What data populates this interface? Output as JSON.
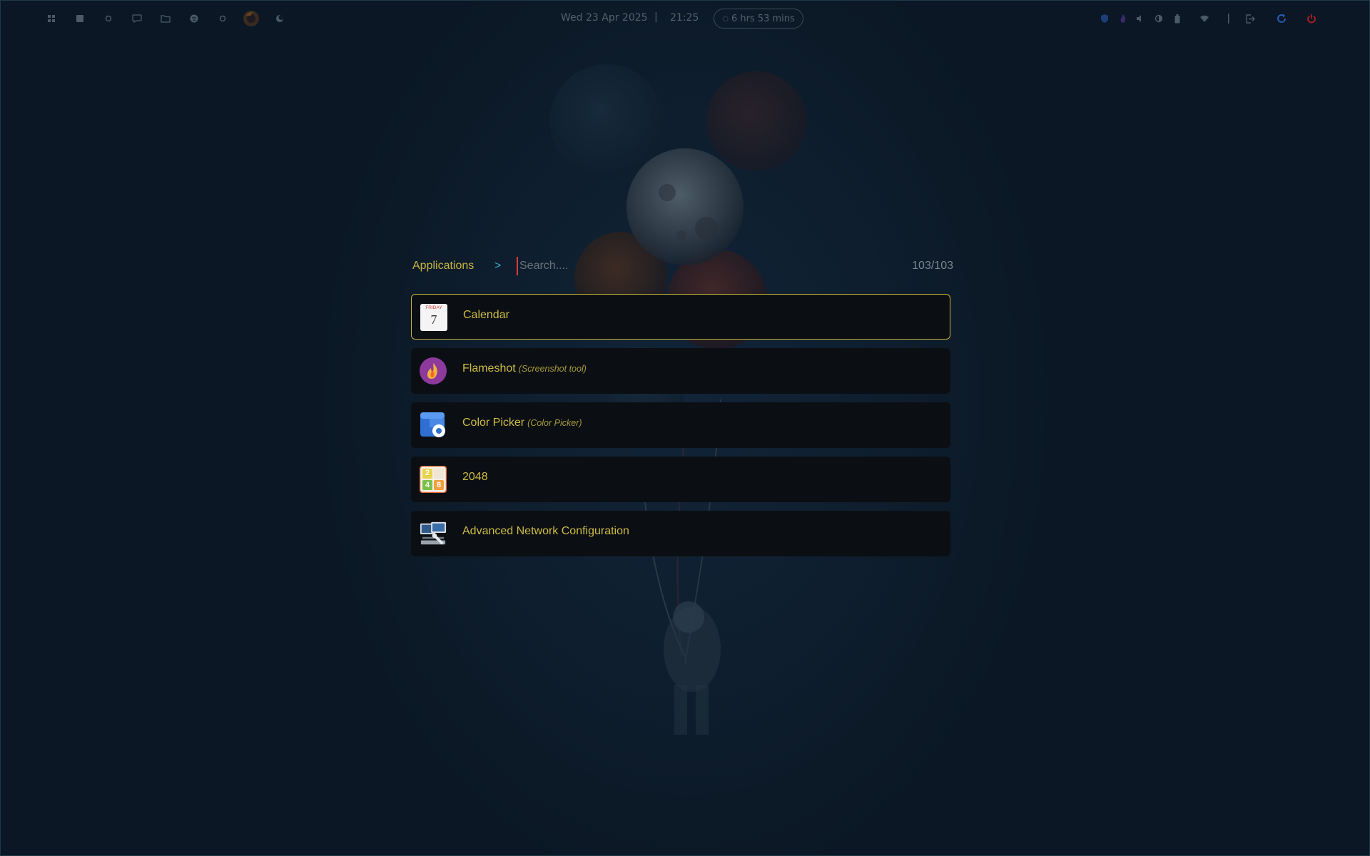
{
  "topbar": {
    "left_icons": [
      "apps-icon",
      "grid-icon",
      "circle-icon",
      "chat-icon",
      "folder-icon",
      "spotify-icon",
      "circle-outline-icon",
      "firefox-icon",
      "moon-icon"
    ],
    "date": "Wed 23 Apr 2025",
    "separator": "|",
    "time": "21:25",
    "battery_remaining": "6 hrs 53 mins",
    "right_icons": [
      "shield-icon",
      "flame-icon",
      "volume-icon",
      "brightness-icon",
      "battery-icon",
      "wifi-icon",
      "divider",
      "logout-icon",
      "refresh-icon",
      "power-icon"
    ]
  },
  "launcher": {
    "mode": "Applications",
    "separator": ">",
    "search": {
      "value": "",
      "placeholder": "Search...."
    },
    "count": "103/103",
    "items": [
      {
        "name": "Calendar",
        "subtitle": "",
        "icon": "calendar-icon",
        "icon_day": "FRIDAY",
        "icon_date": "7",
        "selected": true
      },
      {
        "name": "Flameshot",
        "subtitle": "(Screenshot tool)",
        "icon": "flameshot-icon",
        "selected": false
      },
      {
        "name": "Color Picker",
        "subtitle": "(Color Picker)",
        "icon": "color-picker-icon",
        "selected": false
      },
      {
        "name": "2048",
        "subtitle": "",
        "icon": "game-2048-icon",
        "icon_tiles": [
          "2",
          "",
          "4",
          "8"
        ],
        "selected": false
      },
      {
        "name": "Advanced Network Configuration",
        "subtitle": "",
        "icon": "network-config-icon",
        "selected": false
      }
    ]
  },
  "colors": {
    "background": "#0c1a28",
    "accent_text": "#cfbb45",
    "selection_border": "#c8b43a",
    "chevron": "#29b0c8",
    "cursor": "#e03a3a",
    "row_bg": "#0b0f13",
    "power_red": "#b4202a",
    "refresh_blue": "#2a5fc0"
  }
}
